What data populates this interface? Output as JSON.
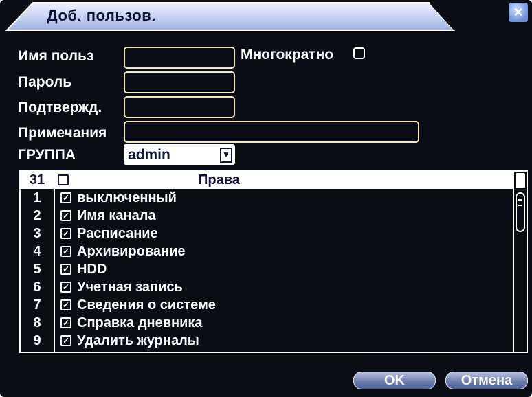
{
  "dialog": {
    "title": "Доб. пользов.",
    "close_symbol": "×"
  },
  "form": {
    "username_label": "Имя польз",
    "username_value": "",
    "multiple_label": "Многократно",
    "multiple_checked": false,
    "password_label": "Пароль",
    "password_value": "",
    "confirm_label": "Подтвержд.",
    "confirm_value": "",
    "notes_label": "Примечания",
    "notes_value": "",
    "group_label": "ГРУППА",
    "group_value": "admin"
  },
  "rights_table": {
    "count": "31",
    "header_label": "Права",
    "rows": [
      {
        "num": "1",
        "label": "выключенный",
        "checked": true
      },
      {
        "num": "2",
        "label": "Имя канала",
        "checked": true
      },
      {
        "num": "3",
        "label": "Расписание",
        "checked": true
      },
      {
        "num": "4",
        "label": "Архивирование",
        "checked": true
      },
      {
        "num": "5",
        "label": "HDD",
        "checked": true
      },
      {
        "num": "6",
        "label": "Учетная запись",
        "checked": true
      },
      {
        "num": "7",
        "label": "Сведения о системе",
        "checked": true
      },
      {
        "num": "8",
        "label": "Справка дневника",
        "checked": true
      },
      {
        "num": "9",
        "label": "Удалить журналы",
        "checked": true
      }
    ]
  },
  "buttons": {
    "ok": "OK",
    "cancel": "Отмена"
  },
  "colors": {
    "background": "#0b0d15",
    "title_bar": "#c7d4f2",
    "field_border": "#f3e7c5"
  }
}
